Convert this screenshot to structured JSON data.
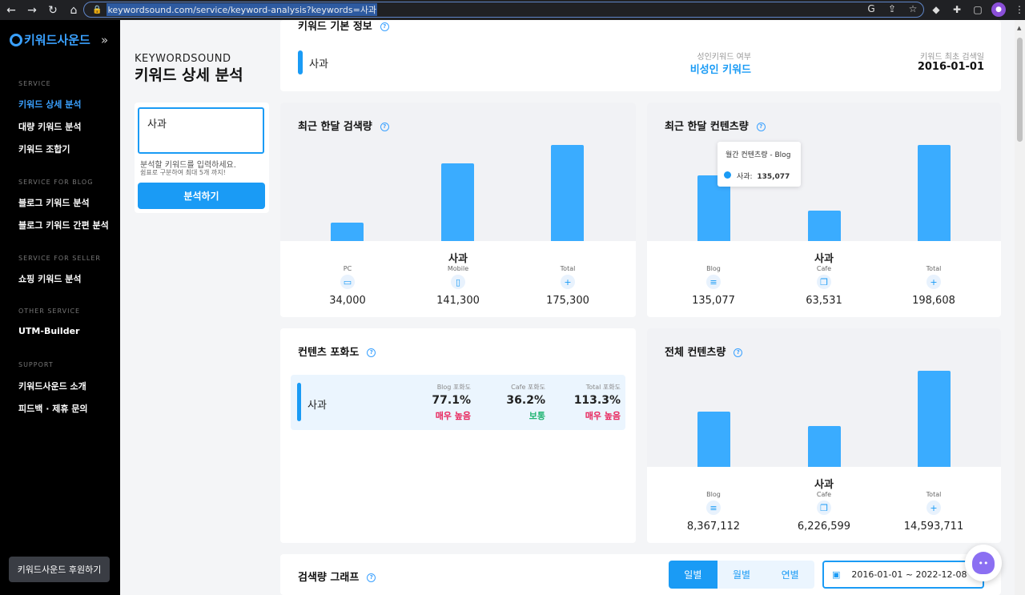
{
  "browser": {
    "url": "keywordsound.com/service/keyword-analysis?keywords=사과"
  },
  "sidebar": {
    "logo": "키워드사운드",
    "sections": [
      {
        "title": "SERVICE",
        "items": [
          "키워드 상세 분석",
          "대량 키워드 분석",
          "키워드 조합기"
        ]
      },
      {
        "title": "SERVICE FOR BLOG",
        "items": [
          "블로그 키워드 분석",
          "블로그 키워드 간편 분석"
        ]
      },
      {
        "title": "SERVICE FOR SELLER",
        "items": [
          "쇼핑 키워드 분석"
        ]
      },
      {
        "title": "OTHER SERVICE",
        "items": [
          "UTM-Builder"
        ]
      },
      {
        "title": "SUPPORT",
        "items": [
          "키워드사운드 소개",
          "피드백 · 제휴 문의"
        ]
      }
    ],
    "active_item": "키워드 상세 분석",
    "sponsor_button": "키워드사운드 후원하기"
  },
  "brand": {
    "en": "KEYWORDSOUND",
    "kr": "키워드 상세 분석"
  },
  "search": {
    "value": "사과",
    "hint1": "분석할 키워드를 입력하세요.",
    "hint2": "쉼표로 구분하여 최대 5개 까지!",
    "button": "분석하기"
  },
  "basic_info": {
    "title": "키워드 기본 정보",
    "keyword": "사과",
    "adult_label": "성인키워드 여부",
    "adult_value": "비성인 키워드",
    "first_search_label": "키워드 최초 검색일",
    "first_search_value": "2016-01-01"
  },
  "search_volume": {
    "title": "최근 한달 검색량",
    "keyword": "사과",
    "stats": [
      {
        "label": "PC",
        "value": "34,000",
        "raw": 34000,
        "icon": "monitor-icon"
      },
      {
        "label": "Mobile",
        "value": "141,300",
        "raw": 141300,
        "icon": "mobile-icon"
      },
      {
        "label": "Total",
        "value": "175,300",
        "raw": 175300,
        "icon": "plus-icon"
      }
    ]
  },
  "content_volume": {
    "title": "최근 한달 컨텐츠량",
    "keyword": "사과",
    "stats": [
      {
        "label": "Blog",
        "value": "135,077",
        "raw": 135077,
        "icon": "document-icon"
      },
      {
        "label": "Cafe",
        "value": "63,531",
        "raw": 63531,
        "icon": "copy-icon"
      },
      {
        "label": "Total",
        "value": "198,608",
        "raw": 198608,
        "icon": "file-plus-icon"
      }
    ],
    "tooltip": {
      "title": "월간 컨텐츠량 - Blog",
      "series": "사과:",
      "value": "135,077"
    }
  },
  "saturation": {
    "title": "컨텐츠 포화도",
    "keyword": "사과",
    "cols": [
      {
        "label": "Blog 포화도",
        "value": "77.1%",
        "grade": "매우 높음",
        "color": "#e8245b"
      },
      {
        "label": "Cafe 포화도",
        "value": "36.2%",
        "grade": "보통",
        "color": "#22b573"
      },
      {
        "label": "Total 포화도",
        "value": "113.3%",
        "grade": "매우 높음",
        "color": "#e8245b"
      }
    ]
  },
  "total_content": {
    "title": "전체 컨텐츠량",
    "keyword": "사과",
    "stats": [
      {
        "label": "Blog",
        "value": "8,367,112",
        "raw": 8367112,
        "icon": "document-icon"
      },
      {
        "label": "Cafe",
        "value": "6,226,599",
        "raw": 6226599,
        "icon": "copy-icon"
      },
      {
        "label": "Total",
        "value": "14,593,711",
        "raw": 14593711,
        "icon": "file-plus-icon"
      }
    ]
  },
  "graph": {
    "title": "검색량 그래프",
    "periods": [
      "일별",
      "월별",
      "연별"
    ],
    "active_period": "일별",
    "date_range": "2016-01-01 ~ 2022-12-08"
  },
  "colors": {
    "accent": "#1a9bf5",
    "bar": "#3aacff",
    "high": "#e8245b",
    "normal": "#22b573"
  }
}
